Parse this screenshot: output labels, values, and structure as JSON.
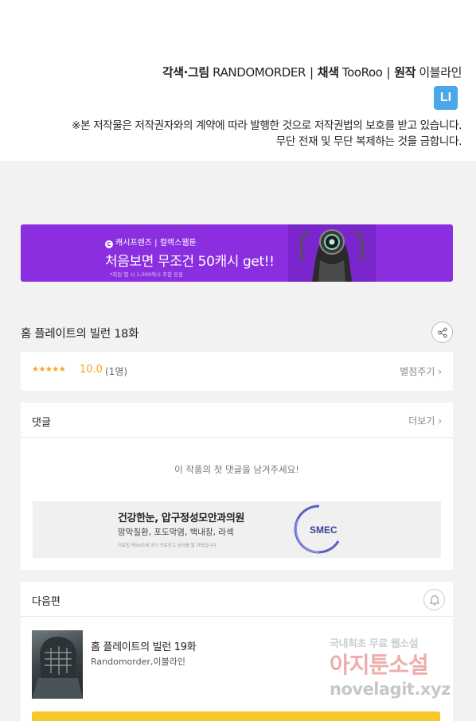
{
  "credits": {
    "art_label": "각색·그림",
    "art_name": "RANDOMORDER",
    "color_label": "채색",
    "color_name": "TooRoo",
    "original_label": "원작",
    "original_name": "이블라인",
    "publisher_logo_text": "LI",
    "notice_line1": "※본 저작물은 저작권자와의 계약에 따라 발행한 것으로 저작권법의 보호를 받고 있습니다.",
    "notice_line2": "무단 전재 및 무단 복제하는 것을 금합니다."
  },
  "banner": {
    "brand": "캐시프렌즈 | 컬렉스웹툰",
    "headline": "처음보면 무조건 50캐시 get!!",
    "fine_print": "*회원 별 시 1,000캐시 추첨 응원",
    "background_color": "#8a2ee0"
  },
  "episode": {
    "title": "홈 플레이트의 빌런 18화",
    "share_icon": "share-icon"
  },
  "rating": {
    "stars": "★★★★★",
    "score": "10.0",
    "count": "(1명)",
    "rate_link": "별점주기 ›",
    "star_color": "#f5a623"
  },
  "comments": {
    "title": "댓글",
    "more_link": "더보기 ›",
    "empty_message": "이 작품의 첫 댓글을 남겨주세요!",
    "ad": {
      "title": "건강한눈, 압구정성모안과의원",
      "subtitle": "망막질환, 포도막염, 백내장, 라섹",
      "fine_print": "의료법 제56조에 의거 의료광고 심의를 필 하였습니다",
      "logo_text": "SMEC"
    }
  },
  "next_episode": {
    "section_title": "다음편",
    "bell_icon": "bell-icon",
    "title": "홈 플레이트의 빌런 19화",
    "author": "Randomorder,이블라인",
    "button_color": "#f7c82b"
  },
  "watermark": {
    "top": "국내최초 무료 웹소설",
    "main": "아지툰소설",
    "url": "novelagit.xyz"
  }
}
